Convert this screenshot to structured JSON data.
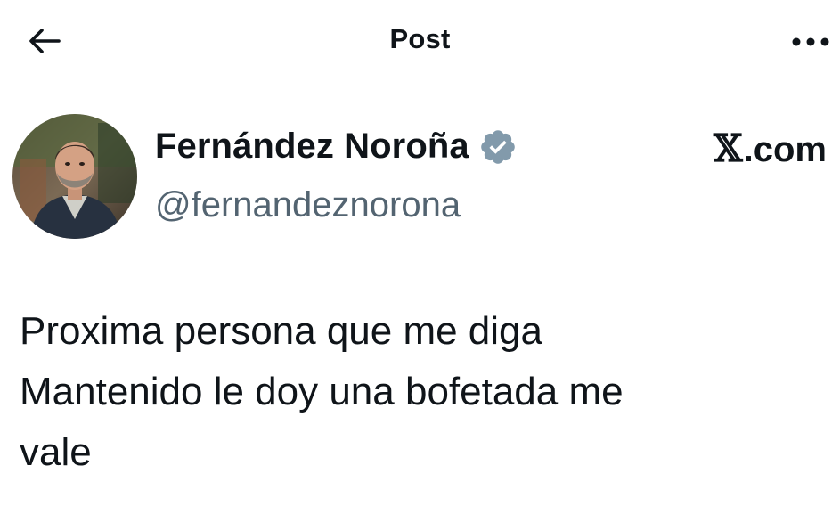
{
  "header": {
    "title": "Post",
    "back_icon": "arrow-left-icon",
    "more_icon": "more-horizontal-icon"
  },
  "author": {
    "display_name": "Fernández Noroña",
    "handle": "@fernandeznorona",
    "verified_icon": "verified-badge-icon",
    "verified_color": "#829aab"
  },
  "source": {
    "x_glyph": "𝕏",
    "domain": ".com"
  },
  "post": {
    "text": "Proxima persona que me diga\nMantenido le doy una bofetada me\nvale"
  },
  "colors": {
    "text": "#0f1419",
    "secondary": "#536471",
    "background": "#ffffff"
  }
}
